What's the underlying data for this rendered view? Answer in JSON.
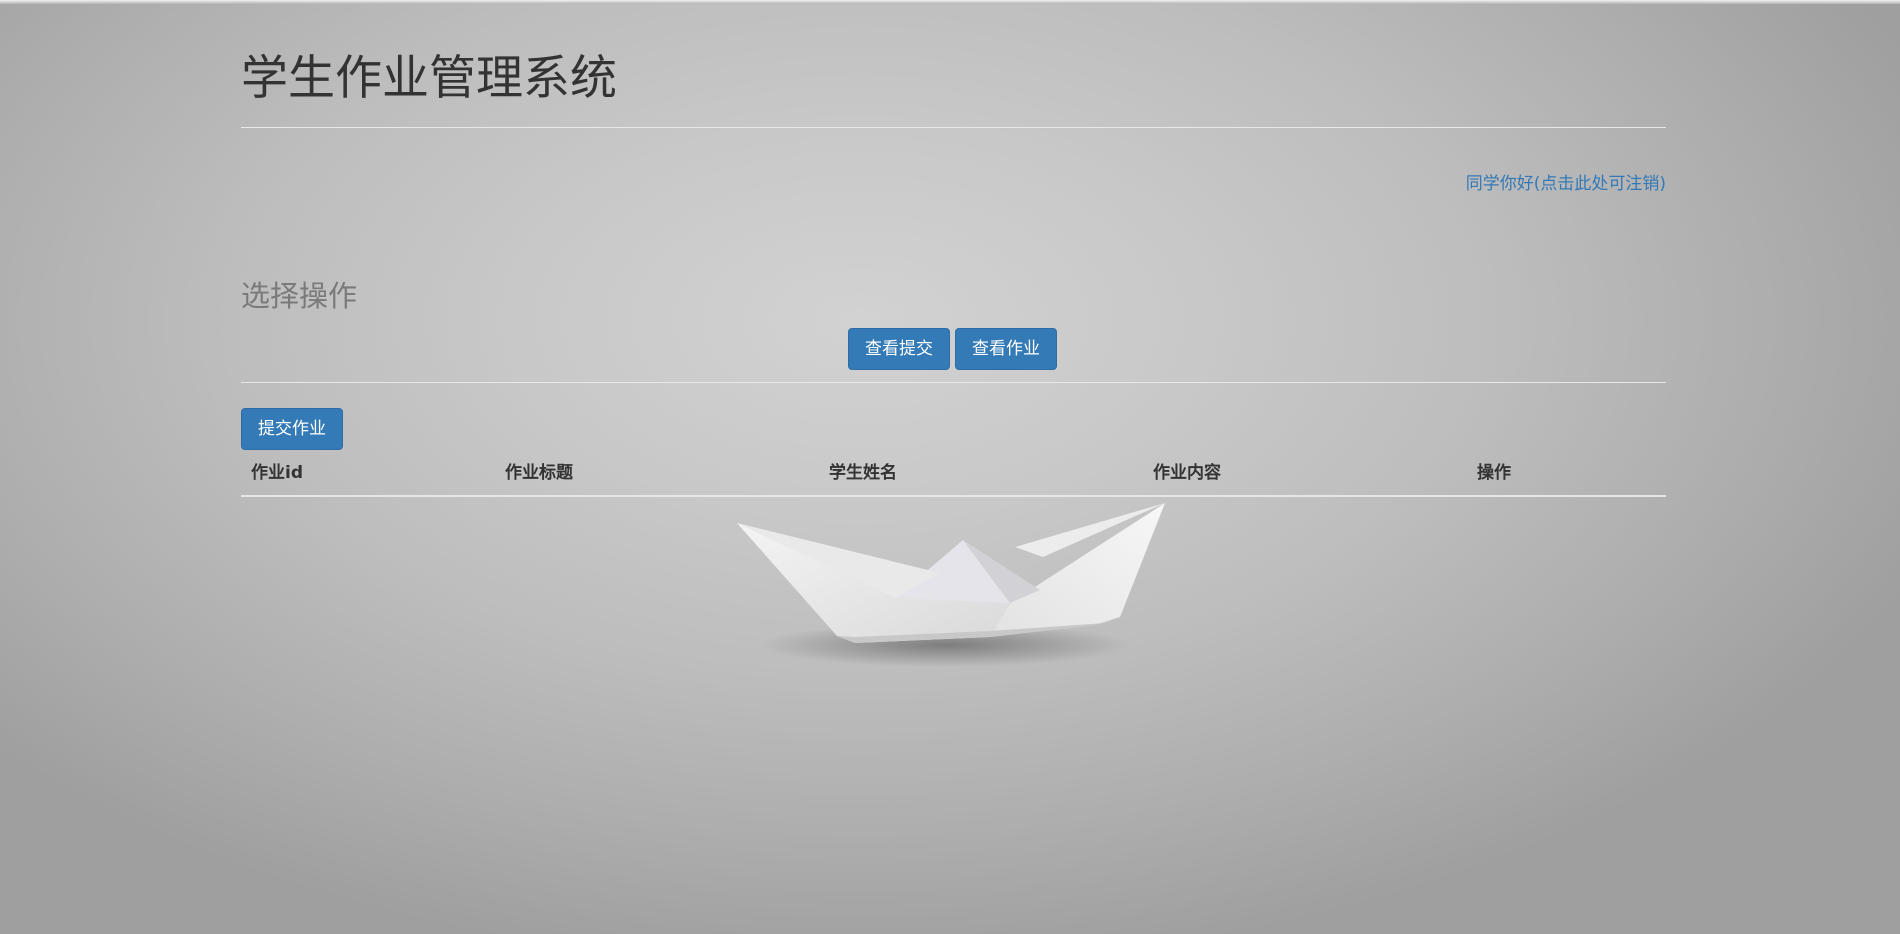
{
  "header": {
    "title": "学生作业管理系统",
    "logout_link": "同学你好(点击此处可注销)"
  },
  "operations": {
    "title": "选择操作",
    "buttons": {
      "view_submissions": "查看提交",
      "view_homework": "查看作业"
    }
  },
  "homework_table": {
    "submit_button": "提交作业",
    "columns": [
      "作业id",
      "作业标题",
      "学生姓名",
      "作业内容",
      "操作"
    ],
    "rows": []
  },
  "decoration": {
    "background_image_icon": "paper-boat-icon"
  }
}
